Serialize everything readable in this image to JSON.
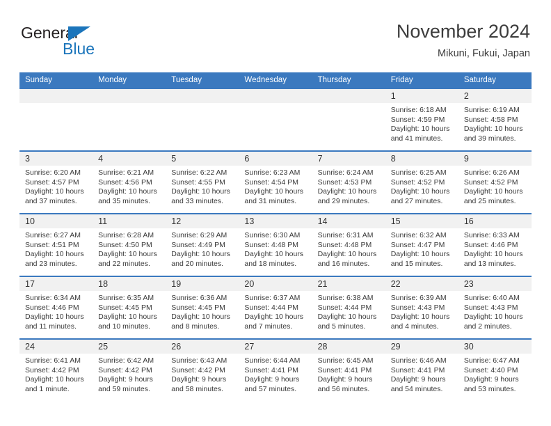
{
  "brand": {
    "name_primary": "General",
    "name_secondary": "Blue",
    "primary_color": "#231f20",
    "secondary_color": "#1b75bb"
  },
  "header": {
    "title": "November 2024",
    "subtitle": "Mikuni, Fukui, Japan"
  },
  "theme": {
    "header_bg": "#3b79bf",
    "header_text": "#ffffff",
    "daynum_bg": "#f1f1f1",
    "cell_bg": "#ffffff",
    "body_text": "#3a3a3a"
  },
  "calendar": {
    "day_headers": [
      "Sunday",
      "Monday",
      "Tuesday",
      "Wednesday",
      "Thursday",
      "Friday",
      "Saturday"
    ],
    "weeks": [
      [
        {
          "day": "",
          "blank": true,
          "lines": []
        },
        {
          "day": "",
          "blank": true,
          "lines": []
        },
        {
          "day": "",
          "blank": true,
          "lines": []
        },
        {
          "day": "",
          "blank": true,
          "lines": []
        },
        {
          "day": "",
          "blank": true,
          "lines": []
        },
        {
          "day": "1",
          "blank": false,
          "lines": [
            "Sunrise: 6:18 AM",
            "Sunset: 4:59 PM",
            "Daylight: 10 hours and 41 minutes."
          ]
        },
        {
          "day": "2",
          "blank": false,
          "lines": [
            "Sunrise: 6:19 AM",
            "Sunset: 4:58 PM",
            "Daylight: 10 hours and 39 minutes."
          ]
        }
      ],
      [
        {
          "day": "3",
          "blank": false,
          "lines": [
            "Sunrise: 6:20 AM",
            "Sunset: 4:57 PM",
            "Daylight: 10 hours and 37 minutes."
          ]
        },
        {
          "day": "4",
          "blank": false,
          "lines": [
            "Sunrise: 6:21 AM",
            "Sunset: 4:56 PM",
            "Daylight: 10 hours and 35 minutes."
          ]
        },
        {
          "day": "5",
          "blank": false,
          "lines": [
            "Sunrise: 6:22 AM",
            "Sunset: 4:55 PM",
            "Daylight: 10 hours and 33 minutes."
          ]
        },
        {
          "day": "6",
          "blank": false,
          "lines": [
            "Sunrise: 6:23 AM",
            "Sunset: 4:54 PM",
            "Daylight: 10 hours and 31 minutes."
          ]
        },
        {
          "day": "7",
          "blank": false,
          "lines": [
            "Sunrise: 6:24 AM",
            "Sunset: 4:53 PM",
            "Daylight: 10 hours and 29 minutes."
          ]
        },
        {
          "day": "8",
          "blank": false,
          "lines": [
            "Sunrise: 6:25 AM",
            "Sunset: 4:52 PM",
            "Daylight: 10 hours and 27 minutes."
          ]
        },
        {
          "day": "9",
          "blank": false,
          "lines": [
            "Sunrise: 6:26 AM",
            "Sunset: 4:52 PM",
            "Daylight: 10 hours and 25 minutes."
          ]
        }
      ],
      [
        {
          "day": "10",
          "blank": false,
          "lines": [
            "Sunrise: 6:27 AM",
            "Sunset: 4:51 PM",
            "Daylight: 10 hours and 23 minutes."
          ]
        },
        {
          "day": "11",
          "blank": false,
          "lines": [
            "Sunrise: 6:28 AM",
            "Sunset: 4:50 PM",
            "Daylight: 10 hours and 22 minutes."
          ]
        },
        {
          "day": "12",
          "blank": false,
          "lines": [
            "Sunrise: 6:29 AM",
            "Sunset: 4:49 PM",
            "Daylight: 10 hours and 20 minutes."
          ]
        },
        {
          "day": "13",
          "blank": false,
          "lines": [
            "Sunrise: 6:30 AM",
            "Sunset: 4:48 PM",
            "Daylight: 10 hours and 18 minutes."
          ]
        },
        {
          "day": "14",
          "blank": false,
          "lines": [
            "Sunrise: 6:31 AM",
            "Sunset: 4:48 PM",
            "Daylight: 10 hours and 16 minutes."
          ]
        },
        {
          "day": "15",
          "blank": false,
          "lines": [
            "Sunrise: 6:32 AM",
            "Sunset: 4:47 PM",
            "Daylight: 10 hours and 15 minutes."
          ]
        },
        {
          "day": "16",
          "blank": false,
          "lines": [
            "Sunrise: 6:33 AM",
            "Sunset: 4:46 PM",
            "Daylight: 10 hours and 13 minutes."
          ]
        }
      ],
      [
        {
          "day": "17",
          "blank": false,
          "lines": [
            "Sunrise: 6:34 AM",
            "Sunset: 4:46 PM",
            "Daylight: 10 hours and 11 minutes."
          ]
        },
        {
          "day": "18",
          "blank": false,
          "lines": [
            "Sunrise: 6:35 AM",
            "Sunset: 4:45 PM",
            "Daylight: 10 hours and 10 minutes."
          ]
        },
        {
          "day": "19",
          "blank": false,
          "lines": [
            "Sunrise: 6:36 AM",
            "Sunset: 4:45 PM",
            "Daylight: 10 hours and 8 minutes."
          ]
        },
        {
          "day": "20",
          "blank": false,
          "lines": [
            "Sunrise: 6:37 AM",
            "Sunset: 4:44 PM",
            "Daylight: 10 hours and 7 minutes."
          ]
        },
        {
          "day": "21",
          "blank": false,
          "lines": [
            "Sunrise: 6:38 AM",
            "Sunset: 4:44 PM",
            "Daylight: 10 hours and 5 minutes."
          ]
        },
        {
          "day": "22",
          "blank": false,
          "lines": [
            "Sunrise: 6:39 AM",
            "Sunset: 4:43 PM",
            "Daylight: 10 hours and 4 minutes."
          ]
        },
        {
          "day": "23",
          "blank": false,
          "lines": [
            "Sunrise: 6:40 AM",
            "Sunset: 4:43 PM",
            "Daylight: 10 hours and 2 minutes."
          ]
        }
      ],
      [
        {
          "day": "24",
          "blank": false,
          "lines": [
            "Sunrise: 6:41 AM",
            "Sunset: 4:42 PM",
            "Daylight: 10 hours and 1 minute."
          ]
        },
        {
          "day": "25",
          "blank": false,
          "lines": [
            "Sunrise: 6:42 AM",
            "Sunset: 4:42 PM",
            "Daylight: 9 hours and 59 minutes."
          ]
        },
        {
          "day": "26",
          "blank": false,
          "lines": [
            "Sunrise: 6:43 AM",
            "Sunset: 4:42 PM",
            "Daylight: 9 hours and 58 minutes."
          ]
        },
        {
          "day": "27",
          "blank": false,
          "lines": [
            "Sunrise: 6:44 AM",
            "Sunset: 4:41 PM",
            "Daylight: 9 hours and 57 minutes."
          ]
        },
        {
          "day": "28",
          "blank": false,
          "lines": [
            "Sunrise: 6:45 AM",
            "Sunset: 4:41 PM",
            "Daylight: 9 hours and 56 minutes."
          ]
        },
        {
          "day": "29",
          "blank": false,
          "lines": [
            "Sunrise: 6:46 AM",
            "Sunset: 4:41 PM",
            "Daylight: 9 hours and 54 minutes."
          ]
        },
        {
          "day": "30",
          "blank": false,
          "lines": [
            "Sunrise: 6:47 AM",
            "Sunset: 4:40 PM",
            "Daylight: 9 hours and 53 minutes."
          ]
        }
      ]
    ]
  }
}
